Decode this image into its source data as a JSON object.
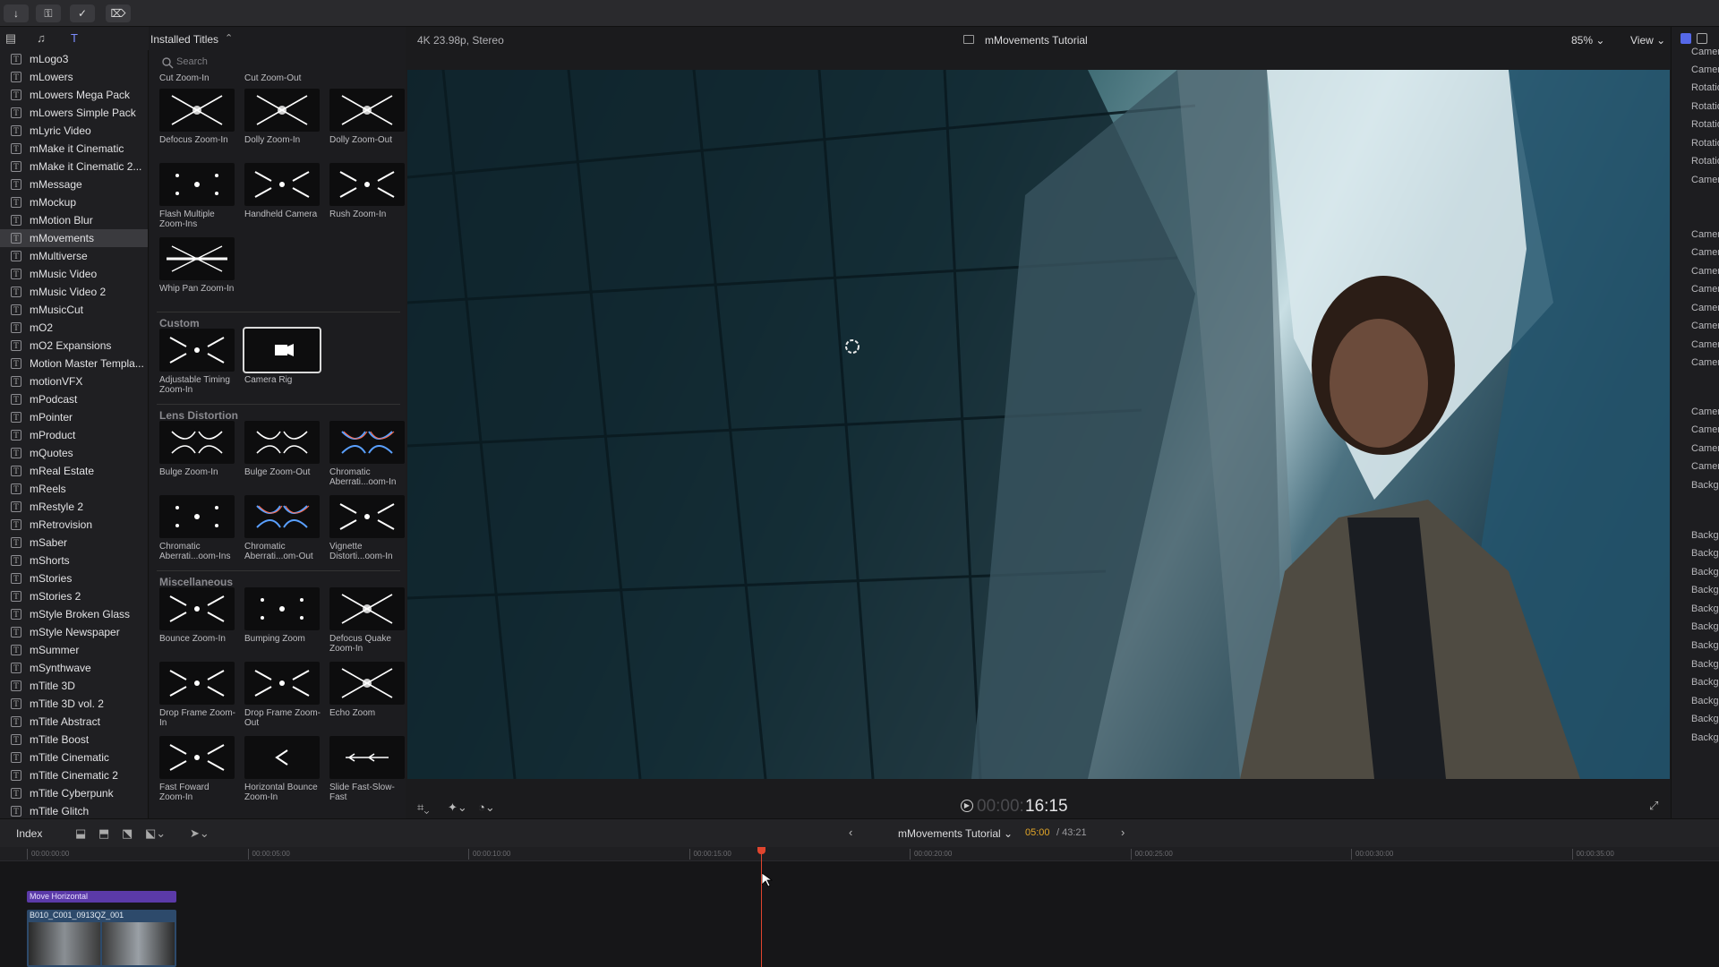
{
  "toolbar": {
    "buttons": [
      "↓",
      "⚿",
      "✓",
      "⌦"
    ]
  },
  "sidebar": {
    "items": [
      "mLogo3",
      "mLowers",
      "mLowers Mega Pack",
      "mLowers Simple Pack",
      "mLyric Video",
      "mMake it Cinematic",
      "mMake it Cinematic 2...",
      "mMessage",
      "mMockup",
      "mMotion Blur",
      "mMovements",
      "mMultiverse",
      "mMusic Video",
      "mMusic Video 2",
      "mMusicCut",
      "mO2",
      "mO2 Expansions",
      "Motion Master Templa...",
      "motionVFX",
      "mPodcast",
      "mPointer",
      "mProduct",
      "mQuotes",
      "mReal Estate",
      "mReels",
      "mRestyle 2",
      "mRetrovision",
      "mSaber",
      "mShorts",
      "mStories",
      "mStories 2",
      "mStyle Broken Glass",
      "mStyle Newspaper",
      "mSummer",
      "mSynthwave",
      "mTitle 3D",
      "mTitle 3D vol. 2",
      "mTitle Abstract",
      "mTitle Boost",
      "mTitle Cinematic",
      "mTitle Cinematic 2",
      "mTitle Cyberpunk",
      "mTitle Glitch"
    ],
    "selected": "mMovements",
    "item_icon": "T"
  },
  "browser": {
    "title": "Installed Titles",
    "sort_icon": "⌃",
    "search_placeholder": "Search",
    "cut_row": [
      "Cut Zoom-In",
      "Cut Zoom-Out"
    ],
    "sections": {
      "custom": "Custom",
      "lens": "Lens Distortion",
      "misc": "Miscellaneous"
    },
    "tiles": {
      "defocus_zoom_in": "Defocus Zoom-In",
      "dolly_zoom_in": "Dolly Zoom-In",
      "dolly_zoom_out": "Dolly Zoom-Out",
      "flash_multiple": "Flash Multiple Zoom-Ins",
      "handheld_camera": "Handheld Camera",
      "rush_zoom_in": "Rush Zoom-In",
      "whip_pan": "Whip Pan Zoom-In",
      "adjustable_timing": "Adjustable Timing Zoom-In",
      "camera_rig": "Camera Rig",
      "bulge_zoom_in": "Bulge Zoom-In",
      "bulge_zoom_out": "Bulge Zoom-Out",
      "chromatic_in": "Chromatic Aberrati...oom-In",
      "chromatic_ins": "Chromatic Aberrati...oom-Ins",
      "chromatic_out": "Chromatic Aberrati...om-Out",
      "vignette": "Vignette Distorti...oom-In",
      "bounce_zoom_in": "Bounce Zoom-In",
      "bumping_zoom": "Bumping Zoom",
      "defocus_quake": "Defocus Quake Zoom-In",
      "drop_frame_in": "Drop Frame Zoom-In",
      "drop_frame_out": "Drop Frame Zoom-Out",
      "echo_zoom": "Echo Zoom",
      "fast_forward": "Fast Foward Zoom-In",
      "horizontal_bounce": "Horizontal Bounce Zoom-In",
      "slide_fast": "Slide Fast-Slow-Fast"
    }
  },
  "viewer": {
    "format": "4K 23.98p, Stereo",
    "project": "mMovements Tutorial",
    "zoom": "85%",
    "view_menu": "View",
    "timecode_dim": "00:00:",
    "timecode": "16:15"
  },
  "inspector": {
    "items": [
      "Camera",
      "Camera",
      "Rotation",
      "Rotation",
      "Rotation",
      "Rotation",
      "Rotation",
      "Camera",
      "Camera",
      "Camera",
      "Camera",
      "Camera",
      "Camera",
      "Camera",
      "Camera",
      "Camera",
      "Camera",
      "Camera",
      "Camera",
      "Camera",
      "Background",
      "Background",
      "Background",
      "Background",
      "Background",
      "Background",
      "Background",
      "Background",
      "Background",
      "Background",
      "Background",
      "Background",
      "Background"
    ]
  },
  "timeline": {
    "index_label": "Index",
    "project": "mMovements Tutorial",
    "position": "05:00",
    "duration": "/ 43:21",
    "ruler": [
      "00:00:00:00",
      "00:00:05:00",
      "00:00:10:00",
      "00:00:15:00",
      "00:00:20:00",
      "00:00:25:00",
      "00:00:30:00",
      "00:00:35:00"
    ],
    "title_clip": "Move Horizontal",
    "video_clip": "B010_C001_0913QZ_001"
  },
  "colors": {
    "accent": "#8c6cf0",
    "playhead": "#e0452e",
    "title_clip": "#5b3aa8",
    "video_clip": "#2d4a6b",
    "selection": "#3a3a3e"
  }
}
